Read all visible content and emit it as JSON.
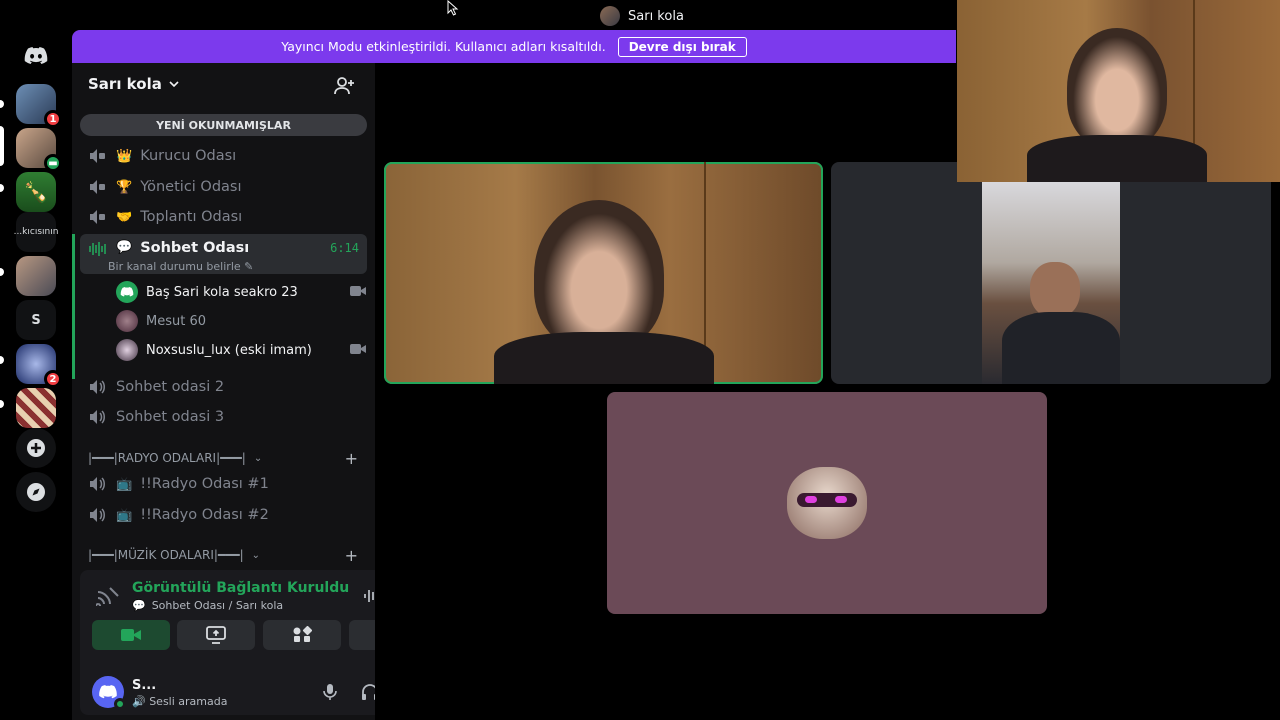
{
  "window": {
    "title": "Sarı kola"
  },
  "banner": {
    "text": "Yayıncı Modu etkinleştirildi. Kullanıcı adları kısaltıldı.",
    "button": "Devre dışı bırak"
  },
  "servers": {
    "items": [
      {
        "name": "discord-home"
      },
      {
        "name": "server-1",
        "badge": "1"
      },
      {
        "name": "server-2"
      },
      {
        "name": "server-3"
      },
      {
        "name": "server-4",
        "label": "...kıcısının"
      },
      {
        "name": "server-5"
      },
      {
        "name": "server-6",
        "label": "S"
      },
      {
        "name": "server-7",
        "badge": "2"
      },
      {
        "name": "server-8"
      }
    ]
  },
  "guild": {
    "name": "Sarı kola",
    "unread_label": "YENİ OKUNMAMIŞLAR"
  },
  "channels": [
    {
      "emoji": "👑",
      "name": "Kurucu Odası"
    },
    {
      "emoji": "🏆",
      "name": "Yönetici Odası"
    },
    {
      "emoji": "🤝",
      "name": "Toplantı Odası"
    },
    {
      "emoji": "💬",
      "name": "Sohbet Odası",
      "time": "6:14",
      "status": "Bir kanal durumu belirle"
    },
    {
      "name": "Sohbet odasi 2"
    },
    {
      "name": "Sohbet odasi 3"
    },
    {
      "emoji": "📺",
      "name": "!!Radyo Odası #1"
    },
    {
      "emoji": "📺",
      "name": "!!Radyo Odası #2"
    }
  ],
  "members": [
    {
      "name": "Baş Sari kola seakro 23"
    },
    {
      "name": "Mesut 60"
    },
    {
      "name": "Noxsuslu_lux (eski imam)"
    }
  ],
  "categories": [
    {
      "name": "|━━━|RADYO ODALARI|━━━|"
    },
    {
      "name": "|━━━|MÜZİK ODALARI|━━━|"
    }
  ],
  "voice": {
    "title": "Görüntülü Bağlantı Kuruldu",
    "subtitle": "Sohbet Odası / Sarı kola"
  },
  "user": {
    "name": "S...",
    "status": "Sesli aramada"
  },
  "colors": {
    "accent": "#7c3aed",
    "online": "#23a55a",
    "badge": "#f23f43"
  }
}
